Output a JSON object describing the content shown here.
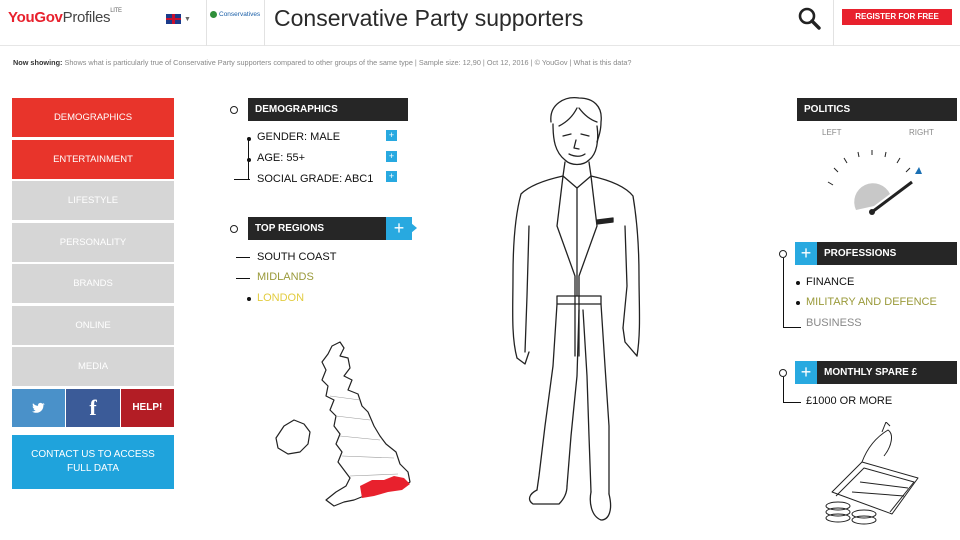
{
  "header": {
    "logo": {
      "you": "You",
      "gov": "Gov",
      "profiles": "Profiles",
      "lite": "LITE"
    },
    "party_logo_text": "Conservatives",
    "title": "Conservative Party supporters",
    "register_label": "REGISTER FOR FREE"
  },
  "now_showing": {
    "label": "Now showing:",
    "text": "Shows what is particularly true of Conservative Party supporters compared to other groups of the same type | Sample size: 12,90 | Oct 12, 2016 | © YouGov | What is this data?"
  },
  "sidebar": {
    "items": [
      {
        "label": "DEMOGRAPHICS",
        "active": true
      },
      {
        "label": "ENTERTAINMENT",
        "active": true
      },
      {
        "label": "LIFESTYLE",
        "active": false
      },
      {
        "label": "PERSONALITY",
        "active": false
      },
      {
        "label": "BRANDS",
        "active": false
      },
      {
        "label": "ONLINE",
        "active": false
      },
      {
        "label": "MEDIA",
        "active": false
      }
    ],
    "help_label": "HELP!",
    "contact_label": "CONTACT US TO ACCESS FULL DATA"
  },
  "demographics": {
    "title": "DEMOGRAPHICS",
    "items": [
      {
        "label": "GENDER: MALE"
      },
      {
        "label": "AGE: 55+"
      },
      {
        "label": "SOCIAL GRADE: ABC1"
      }
    ]
  },
  "top_regions": {
    "title": "TOP REGIONS",
    "items": [
      {
        "label": "SOUTH COAST",
        "color": "#111111"
      },
      {
        "label": "MIDLANDS",
        "color": "#9a9a3a"
      },
      {
        "label": "LONDON",
        "color": "#e2cc40"
      }
    ],
    "highlight_color": "#e8212d"
  },
  "politics": {
    "title": "POLITICS",
    "left_label": "LEFT",
    "right_label": "RIGHT",
    "level": 0.9
  },
  "professions": {
    "title": "PROFESSIONS",
    "items": [
      {
        "label": "FINANCE",
        "color": "#111111"
      },
      {
        "label": "MILITARY AND DEFENCE",
        "color": "#9a9a3a"
      },
      {
        "label": "BUSINESS",
        "color": "#888888"
      }
    ]
  },
  "monthly_spare": {
    "title": "MONTHLY SPARE £",
    "items": [
      {
        "label": "£1000 OR MORE"
      }
    ]
  },
  "colors": {
    "brand_red": "#e8212d",
    "accent_blue": "#28a9e0",
    "dark_header": "#262626",
    "inactive_grey": "#d6d6d6"
  }
}
